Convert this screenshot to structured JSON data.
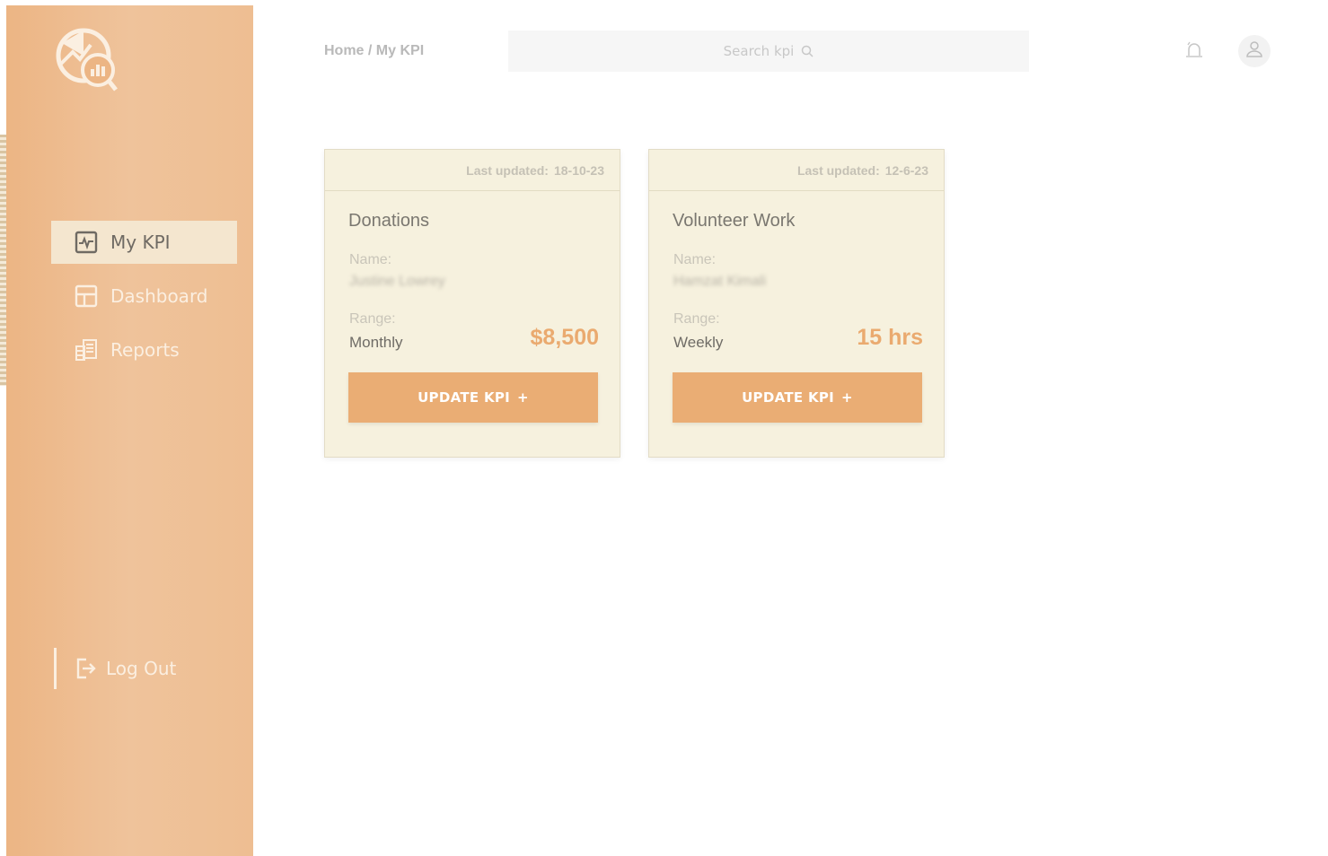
{
  "sidebar": {
    "logo_icon": "kpi-analytics-logo-icon",
    "items": [
      {
        "label": "My KPI",
        "icon": "activity-icon",
        "active": true
      },
      {
        "label": "Dashboard",
        "icon": "layout-icon",
        "active": false
      },
      {
        "label": "Reports",
        "icon": "reports-icon",
        "active": false
      }
    ],
    "logout_label": "Log Out"
  },
  "header": {
    "breadcrumb": "Home / My KPI",
    "search_placeholder": "Search kpi"
  },
  "cards": [
    {
      "last_updated_label": "Last updated:",
      "last_updated": "18-10-23",
      "title": "Donations",
      "name_label": "Name:",
      "name": "Justine Lowrey",
      "range_label": "Range:",
      "range": "Monthly",
      "value": "$8,500",
      "button_label": "UPDATE KPI",
      "button_plus": "+"
    },
    {
      "last_updated_label": "Last updated:",
      "last_updated": "12-6-23",
      "title": "Volunteer Work",
      "name_label": "Name:",
      "name": "Hamzat Kimali",
      "range_label": "Range:",
      "range": "Weekly",
      "value": "15 hrs",
      "button_label": "UPDATE KPI",
      "button_plus": "+"
    }
  ],
  "colors": {
    "sidebar": "#ecb584",
    "accent": "#eaad74",
    "card_bg": "#f6f1de",
    "active_nav_bg": "#f4e6cf"
  }
}
